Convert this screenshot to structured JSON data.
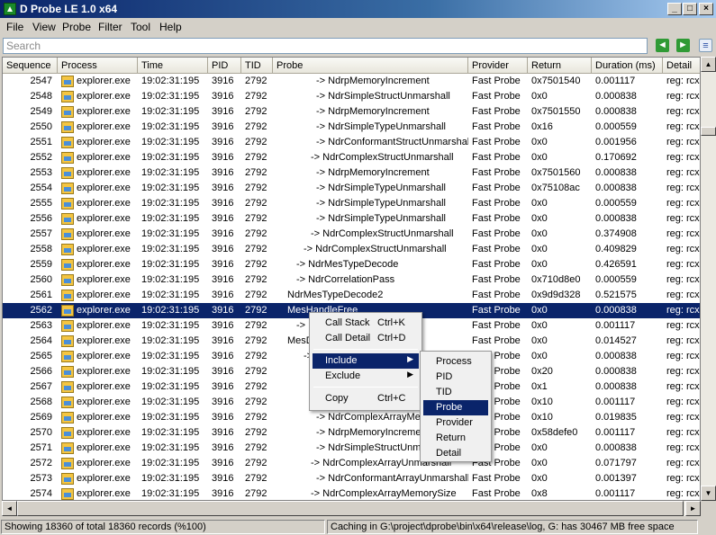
{
  "window": {
    "title": "D Probe LE 1.0 x64"
  },
  "menubar": [
    "File",
    "View",
    "Probe",
    "Filter",
    "Tool",
    "Help"
  ],
  "search": {
    "placeholder": "Search"
  },
  "columns": [
    "Sequence",
    "Process",
    "Time",
    "PID",
    "TID",
    "Probe",
    "Provider",
    "Return",
    "Duration (ms)",
    "Detail"
  ],
  "rows": [
    {
      "seq": "2547",
      "proc": "explorer.exe",
      "time": "19:02:31:195",
      "pid": "3916",
      "tid": "2792",
      "probe": "-> NdrpMemoryIncrement",
      "prov": "Fast Probe",
      "ret": "0x7501540",
      "dur": "0.001117",
      "detail": "reg: rcx"
    },
    {
      "seq": "2548",
      "proc": "explorer.exe",
      "time": "19:02:31:195",
      "pid": "3916",
      "tid": "2792",
      "probe": "-> NdrSimpleStructUnmarshall",
      "prov": "Fast Probe",
      "ret": "0x0",
      "dur": "0.000838",
      "detail": "reg: rcx"
    },
    {
      "seq": "2549",
      "proc": "explorer.exe",
      "time": "19:02:31:195",
      "pid": "3916",
      "tid": "2792",
      "probe": "-> NdrpMemoryIncrement",
      "prov": "Fast Probe",
      "ret": "0x7501550",
      "dur": "0.000838",
      "detail": "reg: rcx"
    },
    {
      "seq": "2550",
      "proc": "explorer.exe",
      "time": "19:02:31:195",
      "pid": "3916",
      "tid": "2792",
      "probe": "-> NdrSimpleTypeUnmarshall",
      "prov": "Fast Probe",
      "ret": "0x16",
      "dur": "0.000559",
      "detail": "reg: rcx"
    },
    {
      "seq": "2551",
      "proc": "explorer.exe",
      "time": "19:02:31:195",
      "pid": "3916",
      "tid": "2792",
      "probe": "-> NdrConformantStructUnmarshall",
      "prov": "Fast Probe",
      "ret": "0x0",
      "dur": "0.001956",
      "detail": "reg: rcx"
    },
    {
      "seq": "2552",
      "proc": "explorer.exe",
      "time": "19:02:31:195",
      "pid": "3916",
      "tid": "2792",
      "probe": "-> NdrComplexStructUnmarshall",
      "prov": "Fast Probe",
      "ret": "0x0",
      "dur": "0.170692",
      "detail": "reg: rcx"
    },
    {
      "seq": "2553",
      "proc": "explorer.exe",
      "time": "19:02:31:195",
      "pid": "3916",
      "tid": "2792",
      "probe": "-> NdrpMemoryIncrement",
      "prov": "Fast Probe",
      "ret": "0x7501560",
      "dur": "0.000838",
      "detail": "reg: rcx"
    },
    {
      "seq": "2554",
      "proc": "explorer.exe",
      "time": "19:02:31:195",
      "pid": "3916",
      "tid": "2792",
      "probe": "-> NdrSimpleTypeUnmarshall",
      "prov": "Fast Probe",
      "ret": "0x75108ac",
      "dur": "0.000838",
      "detail": "reg: rcx"
    },
    {
      "seq": "2555",
      "proc": "explorer.exe",
      "time": "19:02:31:195",
      "pid": "3916",
      "tid": "2792",
      "probe": "-> NdrSimpleTypeUnmarshall",
      "prov": "Fast Probe",
      "ret": "0x0",
      "dur": "0.000559",
      "detail": "reg: rcx"
    },
    {
      "seq": "2556",
      "proc": "explorer.exe",
      "time": "19:02:31:195",
      "pid": "3916",
      "tid": "2792",
      "probe": "-> NdrSimpleTypeUnmarshall",
      "prov": "Fast Probe",
      "ret": "0x0",
      "dur": "0.000838",
      "detail": "reg: rcx"
    },
    {
      "seq": "2557",
      "proc": "explorer.exe",
      "time": "19:02:31:195",
      "pid": "3916",
      "tid": "2792",
      "probe": "-> NdrComplexStructUnmarshall",
      "prov": "Fast Probe",
      "ret": "0x0",
      "dur": "0.374908",
      "detail": "reg: rcx"
    },
    {
      "seq": "2558",
      "proc": "explorer.exe",
      "time": "19:02:31:195",
      "pid": "3916",
      "tid": "2792",
      "probe": "-> NdrComplexStructUnmarshall",
      "prov": "Fast Probe",
      "ret": "0x0",
      "dur": "0.409829",
      "detail": "reg: rcx"
    },
    {
      "seq": "2559",
      "proc": "explorer.exe",
      "time": "19:02:31:195",
      "pid": "3916",
      "tid": "2792",
      "probe": "-> NdrMesTypeDecode",
      "prov": "Fast Probe",
      "ret": "0x0",
      "dur": "0.426591",
      "detail": "reg: rcx"
    },
    {
      "seq": "2560",
      "proc": "explorer.exe",
      "time": "19:02:31:195",
      "pid": "3916",
      "tid": "2792",
      "probe": "-> NdrCorrelationPass",
      "prov": "Fast Probe",
      "ret": "0x710d8e0",
      "dur": "0.000559",
      "detail": "reg: rcx"
    },
    {
      "seq": "2561",
      "proc": "explorer.exe",
      "time": "19:02:31:195",
      "pid": "3916",
      "tid": "2792",
      "probe": "NdrMesTypeDecode2",
      "prov": "Fast Probe",
      "ret": "0x9d9d328",
      "dur": "0.521575",
      "detail": "reg: rcx"
    },
    {
      "seq": "2562",
      "proc": "explorer.exe",
      "time": "19:02:31:195",
      "pid": "3916",
      "tid": "2792",
      "probe": "MesHandleFree",
      "prov": "Fast Probe",
      "ret": "0x0",
      "dur": "0.000838",
      "detail": "reg: rcx"
    },
    {
      "seq": "2563",
      "proc": "explorer.exe",
      "time": "19:02:31:195",
      "pid": "3916",
      "tid": "2792",
      "probe": "-> M",
      "prov": "Fast Probe",
      "ret": "0x0",
      "dur": "0.001117",
      "detail": "reg: rcx"
    },
    {
      "seq": "2564",
      "proc": "explorer.exe",
      "time": "19:02:31:195",
      "pid": "3916",
      "tid": "2792",
      "probe": "MesDec",
      "prov": "Fast Probe",
      "ret": "0x0",
      "dur": "0.014527",
      "detail": "reg: rcx"
    },
    {
      "seq": "2565",
      "proc": "explorer.exe",
      "time": "19:02:31:195",
      "pid": "3916",
      "tid": "2792",
      "probe": "-> N",
      "prov": "Fast Probe",
      "ret": "0x0",
      "dur": "0.000838",
      "detail": "reg: rcx"
    },
    {
      "seq": "2566",
      "proc": "explorer.exe",
      "time": "19:02:31:195",
      "pid": "3916",
      "tid": "2792",
      "probe": "->",
      "prov": "Fast Probe",
      "ret": "0x20",
      "dur": "0.000838",
      "detail": "reg: rcx"
    },
    {
      "seq": "2567",
      "proc": "explorer.exe",
      "time": "19:02:31:195",
      "pid": "3916",
      "tid": "2792",
      "probe": "->",
      "prov": "Fast Probe",
      "ret": "0x1",
      "dur": "0.000838",
      "detail": "reg: rcx"
    },
    {
      "seq": "2568",
      "proc": "explorer.exe",
      "time": "19:02:31:195",
      "pid": "3916",
      "tid": "2792",
      "probe": "",
      "prov": "Fast Probe",
      "ret": "0x10",
      "dur": "0.001117",
      "detail": "reg: rcx"
    },
    {
      "seq": "2569",
      "proc": "explorer.exe",
      "time": "19:02:31:195",
      "pid": "3916",
      "tid": "2792",
      "probe": "-> NdrComplexArrayMemo",
      "prov": "Fast Probe",
      "ret": "0x10",
      "dur": "0.019835",
      "detail": "reg: rcx"
    },
    {
      "seq": "2570",
      "proc": "explorer.exe",
      "time": "19:02:31:195",
      "pid": "3916",
      "tid": "2792",
      "probe": "-> NdrpMemoryIncrement",
      "prov": "Fast Probe",
      "ret": "0x58defe0",
      "dur": "0.001117",
      "detail": "reg: rcx"
    },
    {
      "seq": "2571",
      "proc": "explorer.exe",
      "time": "19:02:31:195",
      "pid": "3916",
      "tid": "2792",
      "probe": "-> NdrSimpleStructUnmars",
      "prov": "Fast Probe",
      "ret": "0x0",
      "dur": "0.000838",
      "detail": "reg: rcx"
    },
    {
      "seq": "2572",
      "proc": "explorer.exe",
      "time": "19:02:31:195",
      "pid": "3916",
      "tid": "2792",
      "probe": "-> NdrComplexArrayUnmarshall",
      "prov": "Fast Probe",
      "ret": "0x0",
      "dur": "0.071797",
      "detail": "reg: rcx"
    },
    {
      "seq": "2573",
      "proc": "explorer.exe",
      "time": "19:02:31:195",
      "pid": "3916",
      "tid": "2792",
      "probe": "-> NdrConformantArrayUnmarshall",
      "prov": "Fast Probe",
      "ret": "0x0",
      "dur": "0.001397",
      "detail": "reg: rcx"
    },
    {
      "seq": "2574",
      "proc": "explorer.exe",
      "time": "19:02:31:195",
      "pid": "3916",
      "tid": "2792",
      "probe": "-> NdrComplexArrayMemorySize",
      "prov": "Fast Probe",
      "ret": "0x8",
      "dur": "0.001117",
      "detail": "reg: rcx"
    }
  ],
  "context_menu": {
    "items": [
      {
        "label": "Call Stack",
        "shortcut": "Ctrl+K"
      },
      {
        "label": "Call Detail",
        "shortcut": "Ctrl+D"
      },
      {
        "label": "Include",
        "shortcut": ""
      },
      {
        "label": "Exclude",
        "shortcut": ""
      },
      {
        "label": "Copy",
        "shortcut": "Ctrl+C"
      }
    ]
  },
  "submenu": [
    "Process",
    "PID",
    "TID",
    "Probe",
    "Provider",
    "Return",
    "Detail"
  ],
  "status": {
    "left": "Showing 18360 of total 18360 records (%100)",
    "right": "Caching in G:\\project\\dprobe\\bin\\x64\\release\\log, G: has 30467 MB free space"
  }
}
